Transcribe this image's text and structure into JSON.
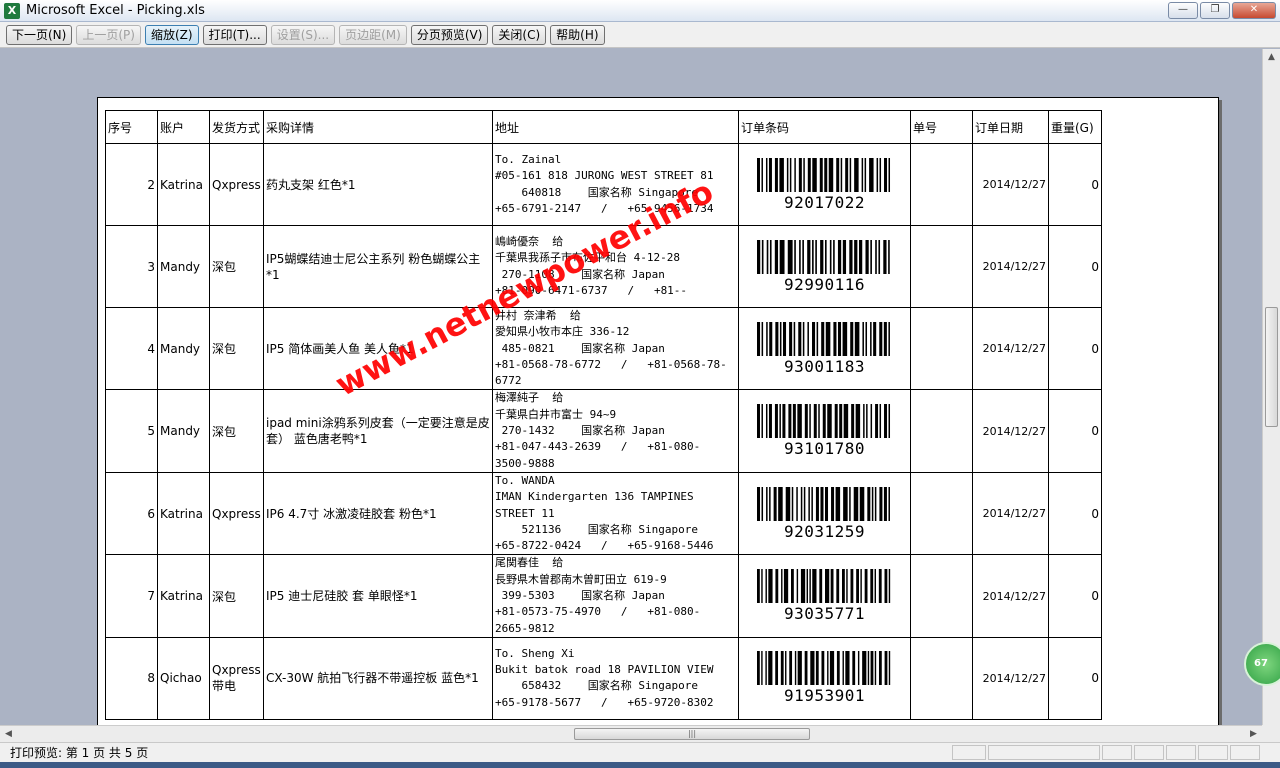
{
  "window": {
    "title": "Microsoft Excel - Picking.xls",
    "app_icon": "X"
  },
  "toolbar": {
    "buttons": [
      {
        "label": "下一页(N)",
        "state": "normal"
      },
      {
        "label": "上一页(P)",
        "state": "disabled"
      },
      {
        "label": "缩放(Z)",
        "state": "active"
      },
      {
        "label": "打印(T)...",
        "state": "normal"
      },
      {
        "label": "设置(S)...",
        "state": "disabled"
      },
      {
        "label": "页边距(M)",
        "state": "disabled"
      },
      {
        "label": "分页预览(V)",
        "state": "normal"
      },
      {
        "label": "关闭(C)",
        "state": "normal"
      },
      {
        "label": "帮助(H)",
        "state": "normal"
      }
    ]
  },
  "sheet": {
    "headers": [
      "序号",
      "账户",
      "发货方式",
      "采购详情",
      "地址",
      "订单条码",
      "单号",
      "订单日期",
      "重量(G)"
    ],
    "rows": [
      {
        "no": "2",
        "account": "Katrina",
        "shipping": "Qxpress",
        "detail": "药丸支架 红色*1",
        "address": "To. Zainal\n#05-161 818 JURONG WEST STREET 81\n    640818    国家名称 Singapore\n+65-6791-2147   /   +65-9456-1734",
        "barcode": "92017022",
        "tracking": "",
        "date": "2014/12/27",
        "weight": "0"
      },
      {
        "no": "3",
        "account": "Mandy",
        "shipping": "深包",
        "detail": "IP5蝴蝶结迪士尼公主系列 粉色蝴蝶公主*1",
        "address": "嶋崎優奈  给\n千葉県我孫子市布佐平和台 4-12-28\n 270-1108    国家名称 Japan\n+81-090-6471-6737   /   +81--",
        "barcode": "92990116",
        "tracking": "",
        "date": "2014/12/27",
        "weight": "0"
      },
      {
        "no": "4",
        "account": "Mandy",
        "shipping": "深包",
        "detail": "IP5 简体画美人鱼 美人鱼*1",
        "address": "井村 奈津希  给\n愛知県小牧市本庄 336-12\n 485-0821    国家名称 Japan\n+81-0568-78-6772   /   +81-0568-78-\n6772",
        "barcode": "93001183",
        "tracking": "",
        "date": "2014/12/27",
        "weight": "0"
      },
      {
        "no": "5",
        "account": "Mandy",
        "shipping": "深包",
        "detail": "ipad mini涂鸦系列皮套（一定要注意是皮套） 蓝色唐老鸭*1",
        "address": "梅澤純子  给\n千葉県白井市富士 94~9\n 270-1432    国家名称 Japan\n+81-047-443-2639   /   +81-080-\n3500-9888",
        "barcode": "93101780",
        "tracking": "",
        "date": "2014/12/27",
        "weight": "0"
      },
      {
        "no": "6",
        "account": "Katrina",
        "shipping": "Qxpress",
        "detail": "IP6 4.7寸 冰激凌硅胶套 粉色*1",
        "address": "To. WANDA\nIMAN Kindergarten 136 TAMPINES\nSTREET 11\n    521136    国家名称 Singapore\n+65-8722-0424   /   +65-9168-5446",
        "barcode": "92031259",
        "tracking": "",
        "date": "2014/12/27",
        "weight": "0"
      },
      {
        "no": "7",
        "account": "Katrina",
        "shipping": "深包",
        "detail": "IP5 迪士尼硅胶  套 单眼怪*1",
        "address": "尾関春佳  给\n長野県木曽郡南木曽町田立 619-9\n 399-5303    国家名称 Japan\n+81-0573-75-4970   /   +81-080-\n2665-9812",
        "barcode": "93035771",
        "tracking": "",
        "date": "2014/12/27",
        "weight": "0"
      },
      {
        "no": "8",
        "account": "Qichao",
        "shipping": "Qxpress带电",
        "detail": "CX-30W 航拍飞行器不带遥控板 蓝色*1",
        "address": "To. Sheng Xi\nBukit batok road 18 PAVILION VIEW\n    658432    国家名称 Singapore\n+65-9178-5677   /   +65-9720-8302",
        "barcode": "91953901",
        "tracking": "",
        "date": "2014/12/27",
        "weight": "0"
      }
    ]
  },
  "watermark": "www.netnewpower.info",
  "statusbar": {
    "text": "打印预览: 第 1 页  共 5 页"
  },
  "badge": "67",
  "colors": {
    "background": "#abb3c4",
    "watermark": "#ff0000"
  }
}
